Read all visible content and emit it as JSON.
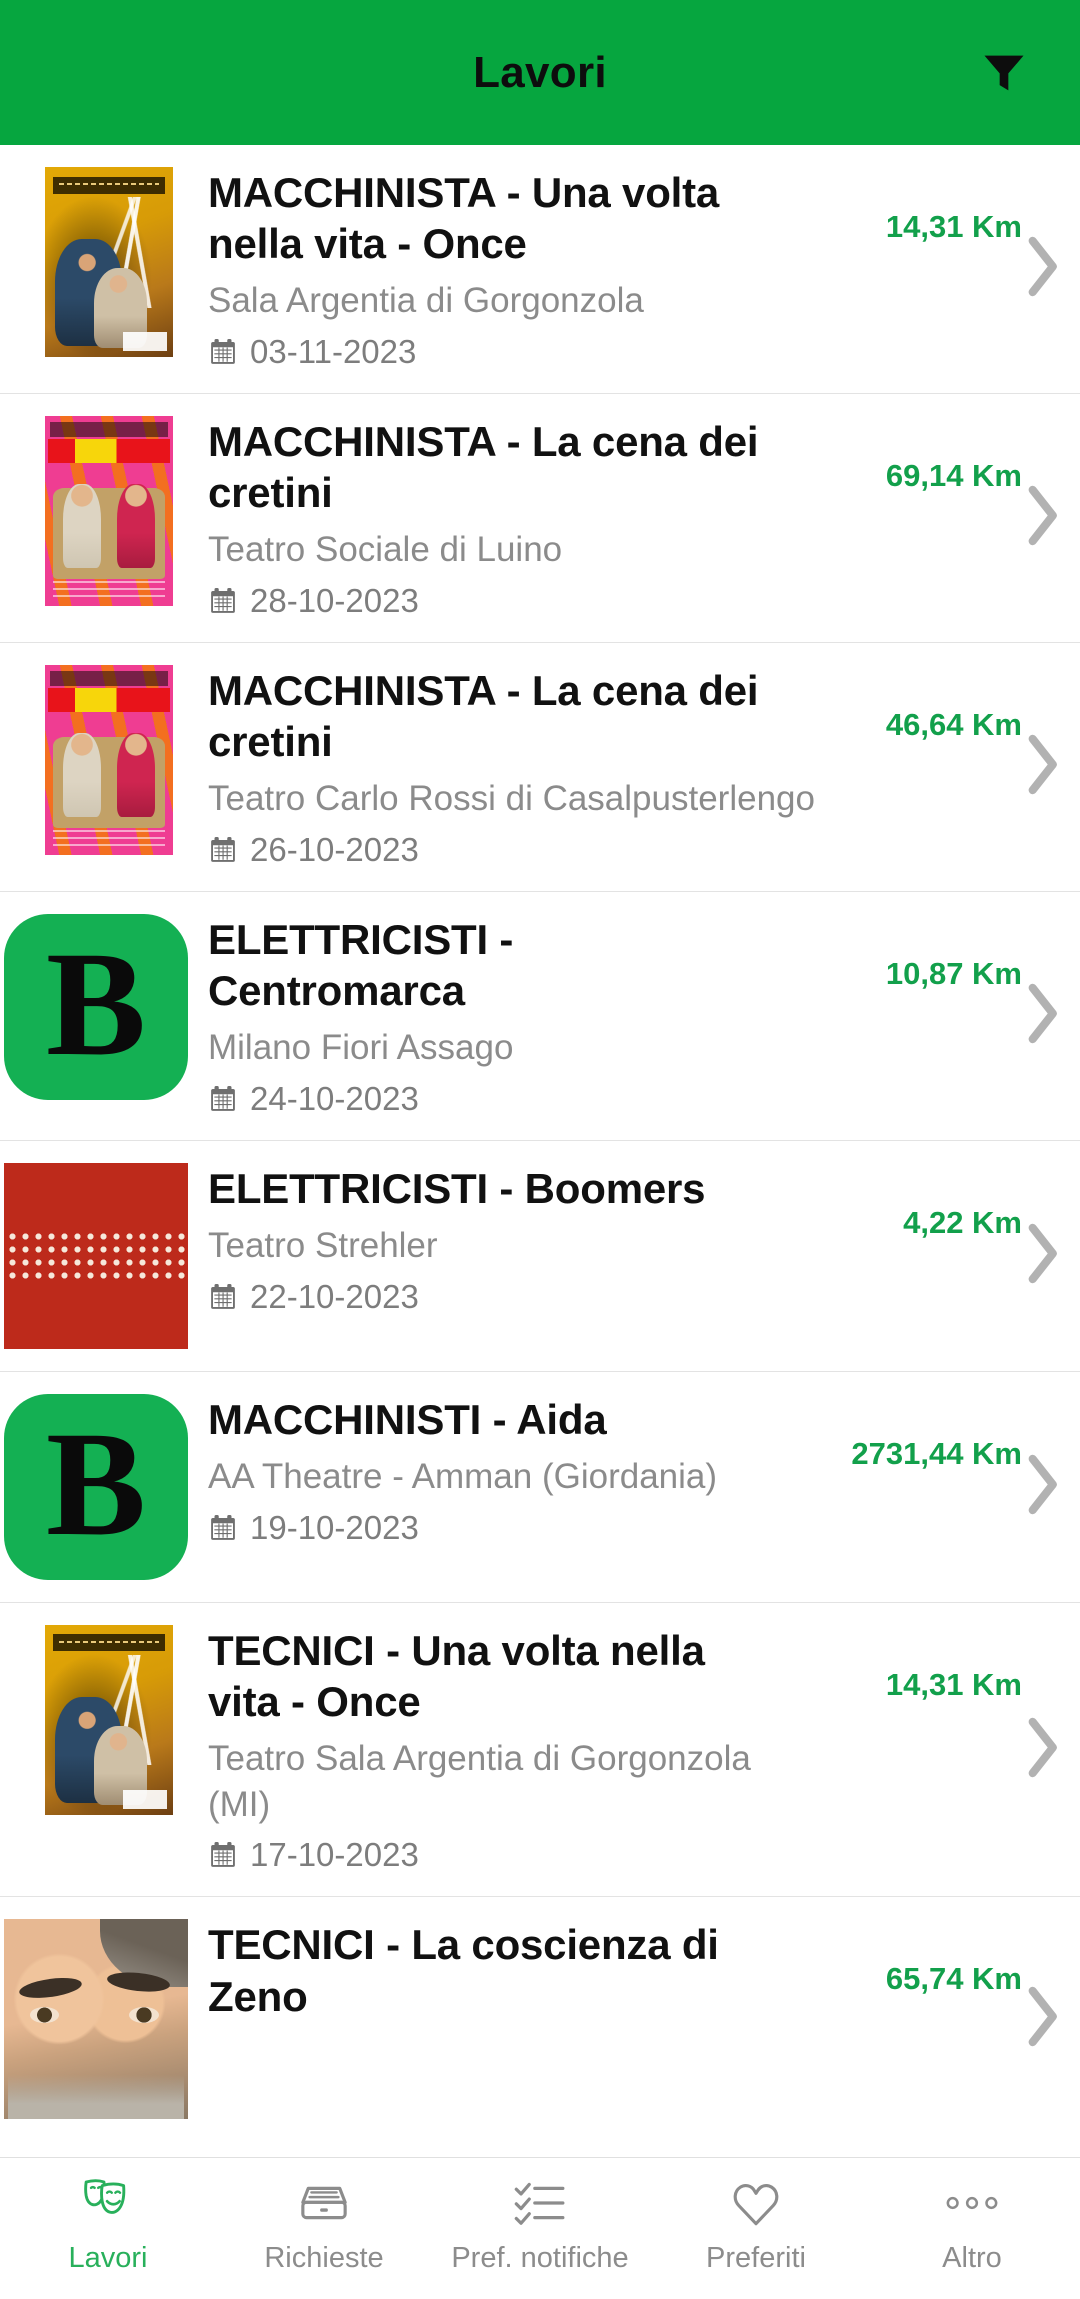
{
  "header": {
    "title": "Lavori",
    "filter_icon": "filter-funnel-icon",
    "bg_color": "#06a63f"
  },
  "theme": {
    "accent_green": "#06a63f",
    "distance_green": "#12a04b",
    "logo_green": "#14b053",
    "muted_text": "#8b8b8b",
    "chevron_gray": "#b0b0b0"
  },
  "list": {
    "items": [
      {
        "title": "MACCHINISTA - Una volta nella vita - Once",
        "venue": "Sala Argentia di Gorgonzola",
        "date": "03-11-2023",
        "distance": "14,31 Km",
        "thumb": "poster-once",
        "date_icon": "calendar-icon",
        "chevron_icon": "chevron-right-icon"
      },
      {
        "title": "MACCHINISTA - La cena dei cretini",
        "venue": "Teatro Sociale di Luino",
        "date": "28-10-2023",
        "distance": "69,14 Km",
        "thumb": "poster-cena",
        "date_icon": "calendar-icon",
        "chevron_icon": "chevron-right-icon"
      },
      {
        "title": "MACCHINISTA - La cena dei cretini",
        "venue": "Teatro Carlo Rossi di Casalpusterlengo",
        "date": "26-10-2023",
        "distance": "46,64 Km",
        "thumb": "poster-cena",
        "date_icon": "calendar-icon",
        "chevron_icon": "chevron-right-icon"
      },
      {
        "title": "ELETTRICISTI - Centromarca",
        "venue": "Milano Fiori Assago",
        "date": "24-10-2023",
        "distance": "10,87 Km",
        "thumb": "logo-b",
        "thumb_letter": "B",
        "date_icon": "calendar-icon",
        "chevron_icon": "chevron-right-icon"
      },
      {
        "title": "ELETTRICISTI - Boomers",
        "venue": "Teatro Strehler",
        "date": "22-10-2023",
        "distance": "4,22 Km",
        "thumb": "logo-piccolo",
        "date_icon": "calendar-icon",
        "chevron_icon": "chevron-right-icon"
      },
      {
        "title": "MACCHINISTI - Aida",
        "venue": "AA Theatre - Amman (Giordania)",
        "date": "19-10-2023",
        "distance": "2731,44 Km",
        "thumb": "logo-b",
        "thumb_letter": "B",
        "date_icon": "calendar-icon",
        "chevron_icon": "chevron-right-icon"
      },
      {
        "title": "TECNICI - Una volta nella vita - Once",
        "venue": "Teatro Sala Argentia di Gorgonzola (MI)",
        "date": "17-10-2023",
        "distance": "14,31 Km",
        "thumb": "poster-once",
        "date_icon": "calendar-icon",
        "chevron_icon": "chevron-right-icon"
      },
      {
        "title": "TECNICI - La coscienza di Zeno",
        "venue": "",
        "date": "",
        "distance": "65,74 Km",
        "thumb": "poster-face",
        "date_icon": "calendar-icon",
        "chevron_icon": "chevron-right-icon"
      }
    ]
  },
  "tabbar": {
    "items": [
      {
        "label": "Lavori",
        "icon": "theater-masks-icon",
        "active": true
      },
      {
        "label": "Richieste",
        "icon": "inbox-tray-icon",
        "active": false
      },
      {
        "label": "Pref. notifiche",
        "icon": "checklist-icon",
        "active": false
      },
      {
        "label": "Preferiti",
        "icon": "heart-icon",
        "active": false
      },
      {
        "label": "Altro",
        "icon": "ellipsis-icon",
        "active": false
      }
    ]
  }
}
